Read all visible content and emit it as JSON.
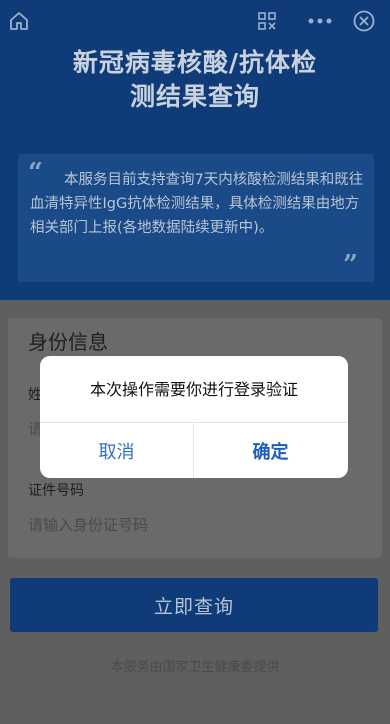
{
  "header": {
    "title_line1": "新冠病毒核酸/抗体检",
    "title_line2": "测结果查询"
  },
  "notice": {
    "text": "本服务目前支持查询7天内核酸检测结果和既往血清特异性IgG抗体检测结果，具体检测结果由地方相关部门上报(各地数据陆续更新中)。",
    "open_quote": "“",
    "close_quote": "”"
  },
  "form": {
    "section_title": "身份信息",
    "name_label": "姓",
    "name_placeholder": "请",
    "id_label": "证件号码",
    "id_placeholder": "请输入身份证号码",
    "submit_label": "立即查询"
  },
  "footer": {
    "note": "本服务由国家卫生健康委提供"
  },
  "dialog": {
    "message": "本次操作需要你进行登录验证",
    "cancel_label": "取消",
    "confirm_label": "确定"
  },
  "icons": {
    "home": "home-icon",
    "scan": "scan-icon",
    "more": "more-icon",
    "close": "close-icon"
  },
  "colors": {
    "primary": "#0f3c78",
    "link": "#2f6fc6"
  }
}
